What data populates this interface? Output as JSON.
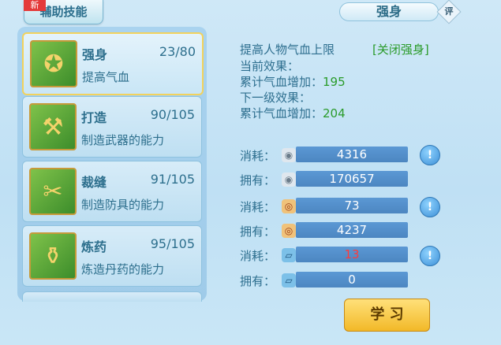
{
  "tabs": {
    "active_label": "辅助技能",
    "badge": "新"
  },
  "header": {
    "title": "强身",
    "rate_label": "评"
  },
  "skills": [
    {
      "name": "强身",
      "level": "23/80",
      "desc": "提高气血"
    },
    {
      "name": "打造",
      "level": "90/105",
      "desc": "制造武器的能力"
    },
    {
      "name": "裁缝",
      "level": "91/105",
      "desc": "制造防具的能力"
    },
    {
      "name": "炼药",
      "level": "95/105",
      "desc": "炼造丹药的能力"
    }
  ],
  "detail": {
    "heading": "提高人物气血上限",
    "toggle": "[关闭强身]",
    "current_label": "当前效果：",
    "current_line": "累计气血增加：",
    "current_value": "195",
    "next_label": "下一级效果：",
    "next_line": "累计气血增加：",
    "next_value": "204"
  },
  "costs": [
    {
      "label": "消耗：",
      "value": "4316"
    },
    {
      "label": "拥有：",
      "value": "170657"
    },
    {
      "label": "消耗：",
      "value": "73"
    },
    {
      "label": "拥有：",
      "value": "4237"
    },
    {
      "label": "消耗：",
      "value": "13"
    },
    {
      "label": "拥有：",
      "value": "0"
    }
  ],
  "learn_button": "学 习"
}
